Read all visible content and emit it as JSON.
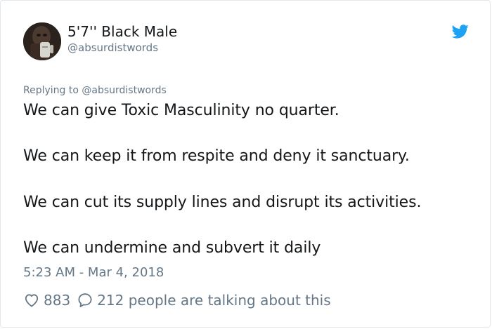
{
  "author": {
    "display_name": "5'7'' Black Male",
    "handle": "@absurdistwords"
  },
  "icons": {
    "brand": "twitter-bird-icon",
    "like": "heart-icon",
    "reply": "speech-bubble-icon",
    "accent": "#1da1f2"
  },
  "tweet": {
    "replying_to": "Replying to @absurdistwords",
    "lines": [
      "We can give Toxic Masculinity no quarter.",
      "We can keep it from respite and deny it sanctuary.",
      "We can cut its supply lines and disrupt its activities.",
      "We can undermine and subvert it daily"
    ],
    "timestamp": "5:23 AM - Mar 4, 2018"
  },
  "engagement": {
    "likes": "883",
    "replies_text": "212 people are talking about this"
  }
}
